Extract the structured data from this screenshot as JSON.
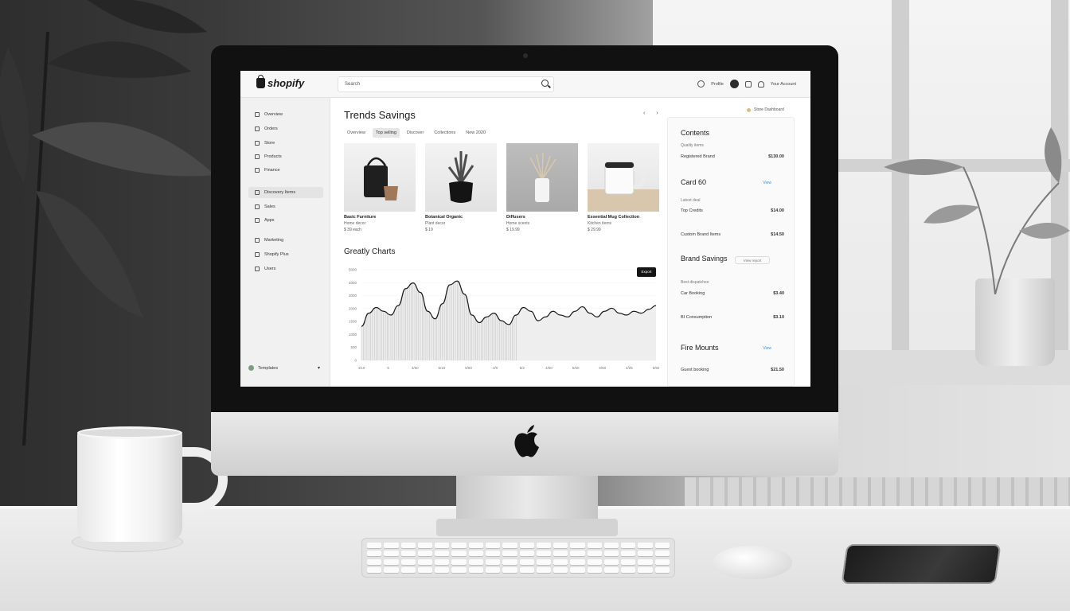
{
  "app": {
    "logo_text": "shopify"
  },
  "topbar": {
    "search_placeholder": "Search",
    "right_label": "Profile",
    "user_label": "Your Account"
  },
  "sidebar": {
    "items": [
      {
        "label": "Overview",
        "icon": "home-icon"
      },
      {
        "label": "Orders",
        "icon": "orders-icon"
      },
      {
        "label": "Store",
        "icon": "store-icon"
      },
      {
        "label": "Products",
        "icon": "products-icon"
      },
      {
        "label": "Finance",
        "icon": "finance-icon"
      },
      {
        "label": "Discovery Items",
        "icon": "discover-icon"
      },
      {
        "label": "Sales",
        "icon": "sales-icon"
      },
      {
        "label": "Apps",
        "icon": "apps-icon"
      },
      {
        "label": "Marketing",
        "icon": "marketing-icon"
      },
      {
        "label": "Shopify Plus",
        "icon": "plus-icon"
      },
      {
        "label": "Users",
        "icon": "users-icon"
      }
    ],
    "bottom_label": "Templates"
  },
  "main": {
    "title": "Trends Savings",
    "pager": "‹ ›",
    "tabs": [
      {
        "label": "Overview"
      },
      {
        "label": "Top selling"
      },
      {
        "label": "Discover"
      },
      {
        "label": "Collections"
      },
      {
        "label": "New 2020"
      }
    ],
    "products": [
      {
        "name": "Basic Furniture",
        "meta": "Home decor",
        "price": "$ 39 each"
      },
      {
        "name": "Botanical Organic",
        "meta": "Plant decor",
        "price": "$ 19"
      },
      {
        "name": "Diffusers",
        "meta": "Home scents",
        "price": "$ 19.99"
      },
      {
        "name": "Essential Mug Collection",
        "meta": "Kitchen items",
        "price": "$ 29.99"
      }
    ],
    "chart_title": "Greatly Charts",
    "export_label": "Export"
  },
  "panel": {
    "header_label": "Store Dashboard",
    "sections": [
      {
        "title": "Contents",
        "sub": "Quality items",
        "rows": [
          {
            "label": "Registered Brand",
            "value": "$130.00"
          }
        ]
      },
      {
        "title": "Card 60",
        "link": "View",
        "sub": "Latest deal",
        "rows": [
          {
            "label": "Top Credits",
            "value": "$14.00"
          },
          {
            "label": "Custom Brand Items",
            "value": "$14.50"
          }
        ]
      },
      {
        "title": "Brand Savings",
        "pill": "View report",
        "sub": "Best dispatches",
        "rows": [
          {
            "label": "Car Booking",
            "value": "$3.40"
          },
          {
            "label": "BI Consumption",
            "value": "$3.10"
          }
        ]
      },
      {
        "title": "Fire Mounts",
        "link": "View",
        "rows": [
          {
            "label": "Guest booking",
            "value": "$21.50"
          }
        ]
      }
    ]
  },
  "chart_data": {
    "type": "area",
    "title": "Greatly Charts",
    "x": [
      0,
      1,
      2,
      3,
      4,
      5,
      6,
      7,
      8,
      9,
      10,
      11,
      12,
      13,
      14,
      15,
      16,
      17,
      18,
      19,
      20,
      21,
      22,
      23,
      24,
      25,
      26,
      27,
      28,
      29,
      30,
      31,
      32,
      33,
      34,
      35,
      36,
      37,
      38,
      39,
      40
    ],
    "x_tick_labels": [
      "4/10",
      "5",
      "4/50",
      "5/10",
      "5/50",
      "4/0",
      "5/2",
      "4/50",
      "5/50",
      "6/50",
      "4/25",
      "5/50"
    ],
    "y": [
      900,
      1250,
      1400,
      1300,
      1200,
      1450,
      1900,
      2050,
      1800,
      1300,
      1100,
      1500,
      2000,
      2100,
      1750,
      1200,
      1000,
      1150,
      1250,
      1050,
      950,
      1200,
      1400,
      1300,
      1050,
      1150,
      1300,
      1200,
      1150,
      1300,
      1420,
      1250,
      1150,
      1300,
      1380,
      1250,
      1200,
      1300,
      1250,
      1350,
      1450
    ],
    "y_tick_labels": [
      "0",
      "500",
      "1000",
      "1500",
      "2000",
      "3000",
      "4000",
      "5000"
    ],
    "ylim": [
      0,
      2400
    ],
    "highlight_until_index": 21,
    "grid": true,
    "color": "#1a1a1a"
  },
  "colors": {
    "accent_link": "#4a8fd6",
    "dark": "#151515"
  }
}
